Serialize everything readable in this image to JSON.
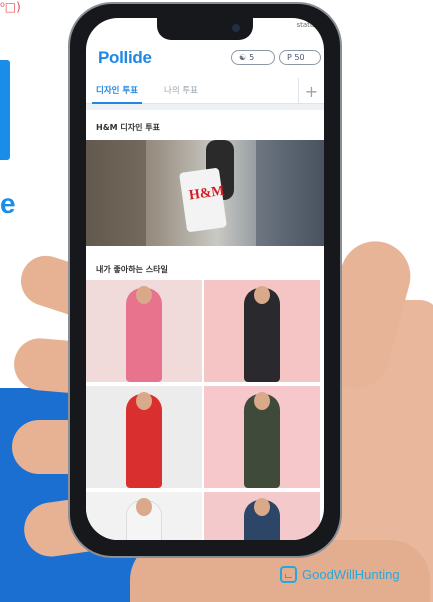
{
  "background": {
    "corner_text": "⁰□)",
    "left_letter": "e",
    "accent": "#1a6fd0"
  },
  "status": {
    "text": "status"
  },
  "app": {
    "logo": "Pollide",
    "points_left": "5",
    "points_right": "P 50",
    "left_icon": "handshake-icon",
    "right_icon": "coin-icon"
  },
  "tabs": [
    {
      "label": "디자인 투표",
      "active": true
    },
    {
      "label": "나의 투표",
      "active": false
    }
  ],
  "sections": {
    "vote_title": "H&M 디자인 투표",
    "hero_bag_text": "H&M",
    "style_title": "내가 좋아하는 스타일"
  },
  "watermark": {
    "text": "GoodWillHunting",
    "icon": "gwh-logo-icon"
  }
}
